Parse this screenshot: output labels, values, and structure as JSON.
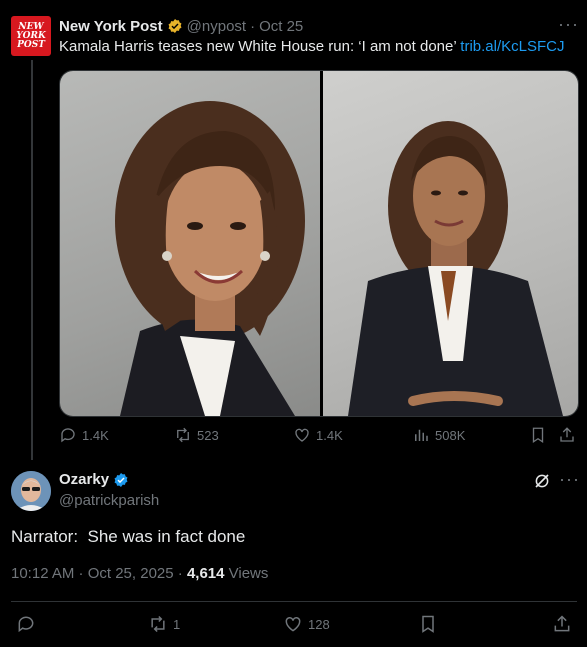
{
  "parent_tweet": {
    "avatar_text": [
      "NEW",
      "YORK",
      "POST"
    ],
    "display_name": "New York Post",
    "handle": "@nypost",
    "separator": "·",
    "date": "Oct 25",
    "more": "···",
    "text": "Kamala Harris teases new White House run: ‘I am not done’ ",
    "link": "trib.al/KcLSFCJ",
    "stats": {
      "replies": "1.4K",
      "reposts": "523",
      "likes": "1.4K",
      "views": "508K"
    }
  },
  "reply_tweet": {
    "display_name": "Ozarky",
    "handle": "@patrickparish",
    "more": "···",
    "text": "Narrator:  She was in fact done",
    "time": "10:12 AM · Oct 25, 2025 · ",
    "view_count": "4,614",
    "views_label": " Views",
    "stats": {
      "reposts": "1",
      "likes": "128"
    }
  },
  "colors": {
    "accent": "#1d9bf0",
    "gold_badge": "#e8b32a",
    "nyp_red": "#d7181f",
    "muted": "#71767b"
  },
  "icons": [
    "gold-verified-icon",
    "more-icon",
    "reply-icon",
    "repost-icon",
    "like-icon",
    "views-icon",
    "bookmark-icon",
    "share-icon",
    "blue-verified-icon",
    "grok-icon"
  ]
}
